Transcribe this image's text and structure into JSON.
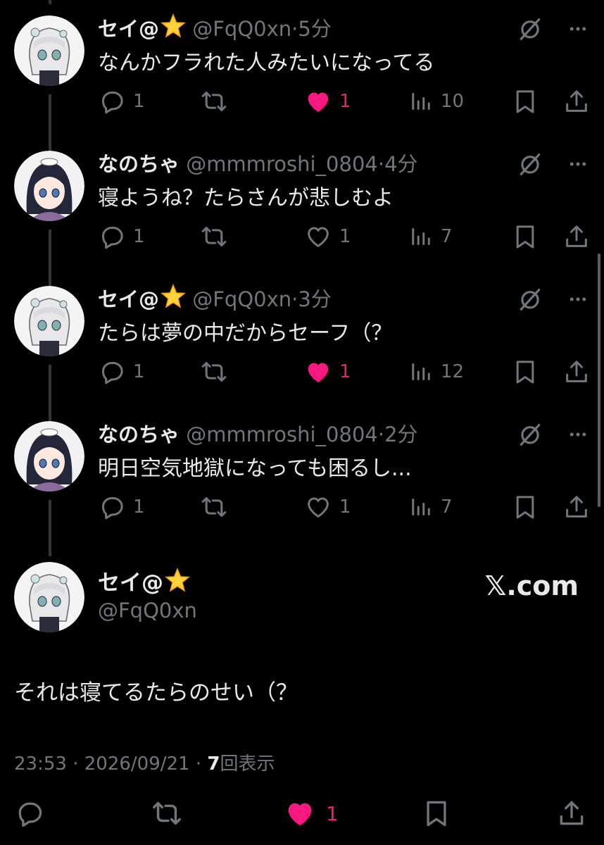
{
  "tweets": [
    {
      "name": "セイ@",
      "handle": "@FqQ0xn",
      "dot": "·",
      "time": "5分",
      "text": "なんかフラれた人みたいになってる",
      "replies": "1",
      "likes": "1",
      "views": "10",
      "liked": true,
      "avatar": "sei"
    },
    {
      "name": "なのちゃ",
      "handle": "@mmmroshi_0804",
      "dot": "·",
      "time": "4分",
      "text": "寝ようね？たらさんが悲しむよ",
      "replies": "1",
      "likes": "1",
      "views": "7",
      "liked": false,
      "avatar": "nano"
    },
    {
      "name": "セイ@",
      "handle": "@FqQ0xn",
      "dot": "·",
      "time": "3分",
      "text": "たらは夢の中だからセーフ（？",
      "replies": "1",
      "likes": "1",
      "views": "12",
      "liked": true,
      "avatar": "sei"
    },
    {
      "name": "なのちゃ",
      "handle": "@mmmroshi_0804",
      "dot": "·",
      "time": "2分",
      "text": "明日空気地獄になっても困るし...",
      "replies": "1",
      "likes": "1",
      "views": "7",
      "liked": false,
      "avatar": "nano"
    }
  ],
  "main_tweet": {
    "name": "セイ@",
    "handle": "@FqQ0xn",
    "watermark": "𝕏.com",
    "text": "それは寝てるたらのせい（？",
    "time": "23:53",
    "sep1": "·",
    "date": "2026/09/21",
    "sep2": "·",
    "views": "7",
    "views_label": "回表示",
    "likes": "1"
  },
  "colors": {
    "background": "#000000",
    "text": "#e7e9ea",
    "secondary": "#71767b",
    "like": "#f91880"
  }
}
